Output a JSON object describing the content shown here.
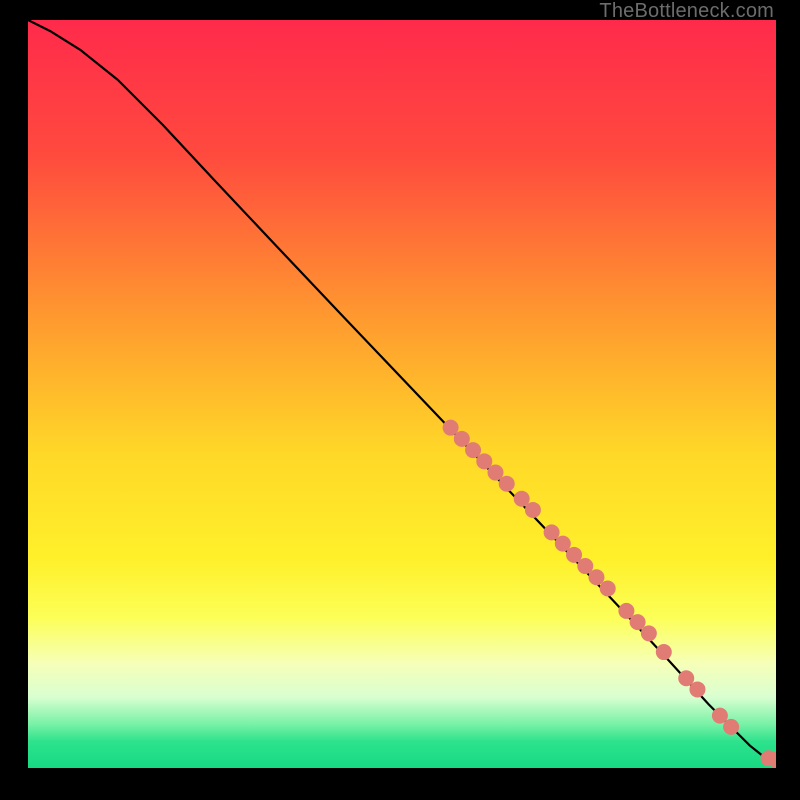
{
  "watermark": {
    "text": "TheBottleneck.com"
  },
  "chart_data": {
    "type": "line",
    "title": "",
    "xlabel": "",
    "ylabel": "",
    "xlim": [
      0,
      100
    ],
    "ylim": [
      0,
      100
    ],
    "grid": false,
    "background_gradient": {
      "stops": [
        {
          "offset": 0.0,
          "color": "#ff2a4b"
        },
        {
          "offset": 0.18,
          "color": "#ff4a3e"
        },
        {
          "offset": 0.4,
          "color": "#ff9a2f"
        },
        {
          "offset": 0.58,
          "color": "#ffd828"
        },
        {
          "offset": 0.72,
          "color": "#fff02a"
        },
        {
          "offset": 0.8,
          "color": "#fcff58"
        },
        {
          "offset": 0.86,
          "color": "#f6ffb8"
        },
        {
          "offset": 0.905,
          "color": "#d9ffd0"
        },
        {
          "offset": 0.94,
          "color": "#7cf2a8"
        },
        {
          "offset": 0.965,
          "color": "#2de28c"
        },
        {
          "offset": 1.0,
          "color": "#17d983"
        }
      ]
    },
    "series": [
      {
        "name": "curve",
        "type": "line",
        "color": "#000000",
        "x": [
          0,
          3,
          7,
          12,
          18,
          25,
          33,
          42,
          52,
          62,
          72,
          80,
          86,
          91,
          94.5,
          96.5,
          98,
          99.5,
          100
        ],
        "y": [
          100,
          98.5,
          96,
          92,
          86,
          78.5,
          70,
          60.5,
          50,
          39.5,
          29,
          20.5,
          14,
          8.5,
          5,
          3,
          1.8,
          1.2,
          1.1
        ]
      },
      {
        "name": "bottleneck-points",
        "type": "scatter",
        "color": "#e07c74",
        "radius": 8,
        "points": [
          {
            "x": 56.5,
            "y": 45.5
          },
          {
            "x": 58.0,
            "y": 44.0
          },
          {
            "x": 59.5,
            "y": 42.5
          },
          {
            "x": 61.0,
            "y": 41.0
          },
          {
            "x": 62.5,
            "y": 39.5
          },
          {
            "x": 64.0,
            "y": 38.0
          },
          {
            "x": 66.0,
            "y": 36.0
          },
          {
            "x": 67.5,
            "y": 34.5
          },
          {
            "x": 70.0,
            "y": 31.5
          },
          {
            "x": 71.5,
            "y": 30.0
          },
          {
            "x": 73.0,
            "y": 28.5
          },
          {
            "x": 74.5,
            "y": 27.0
          },
          {
            "x": 76.0,
            "y": 25.5
          },
          {
            "x": 77.5,
            "y": 24.0
          },
          {
            "x": 80.0,
            "y": 21.0
          },
          {
            "x": 81.5,
            "y": 19.5
          },
          {
            "x": 83.0,
            "y": 18.0
          },
          {
            "x": 85.0,
            "y": 15.5
          },
          {
            "x": 88.0,
            "y": 12.0
          },
          {
            "x": 89.5,
            "y": 10.5
          },
          {
            "x": 92.5,
            "y": 7.0
          },
          {
            "x": 94.0,
            "y": 5.5
          },
          {
            "x": 99.0,
            "y": 1.3
          },
          {
            "x": 100.0,
            "y": 1.1
          }
        ]
      }
    ]
  }
}
